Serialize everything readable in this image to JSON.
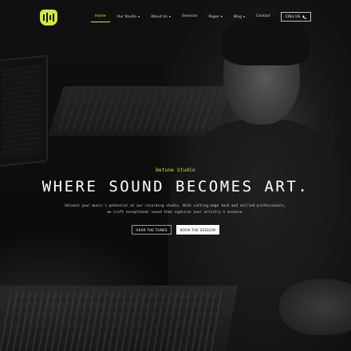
{
  "brand": {
    "logo_icon": "headphones-logo-icon",
    "accent_color": "#d7e63a"
  },
  "nav": {
    "items": [
      {
        "label": "Home",
        "active": true,
        "has_dropdown": false
      },
      {
        "label": "Our Studio",
        "active": false,
        "has_dropdown": true
      },
      {
        "label": "About Us",
        "active": false,
        "has_dropdown": true
      },
      {
        "label": "Services",
        "active": false,
        "has_dropdown": false
      },
      {
        "label": "Pages",
        "active": false,
        "has_dropdown": true
      },
      {
        "label": "Blog",
        "active": false,
        "has_dropdown": true
      },
      {
        "label": "Contact",
        "active": false,
        "has_dropdown": false
      }
    ],
    "dropdown_glyph": "▾"
  },
  "call_button": {
    "label": "CALL US",
    "icon": "phone-icon"
  },
  "hero": {
    "eyebrow": "Detune Studio",
    "headline": "WHERE SOUND BECOMES ART.",
    "description_line1": "Unleash your music's potential at our recording studio. With cutting-edge tech and skilled professionals,",
    "description_line2": "we craft exceptional sound that captures your artistry's essence.",
    "primary_cta": "HEAR THE TUNES",
    "secondary_cta": "BOOK THE SESSION"
  }
}
